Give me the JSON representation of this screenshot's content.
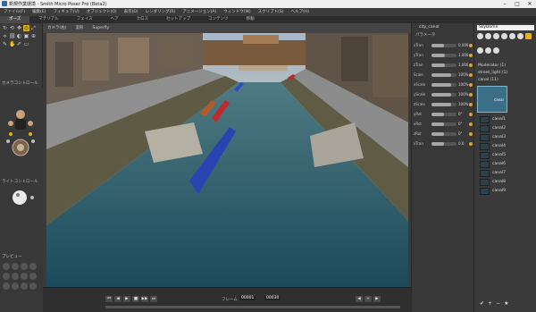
{
  "window": {
    "title": "新規作業環境 - Smith Micro Poser Pro (Beta2)"
  },
  "menu": [
    "ファイル(F)",
    "編集(E)",
    "フィギュア(U)",
    "オブジェクト(O)",
    "表示(D)",
    "レンダリング(R)",
    "アニメーション(A)",
    "ウィンドウ(W)",
    "スクリプト(S)",
    "ヘルプ(H)"
  ],
  "tabs": [
    {
      "label": "ポーズ",
      "active": true
    },
    {
      "label": "マテリアル",
      "active": false
    },
    {
      "label": "フェイス",
      "active": false
    },
    {
      "label": "ヘア",
      "active": false
    },
    {
      "label": "クロス",
      "active": false
    },
    {
      "label": "セットアップ",
      "active": false
    },
    {
      "label": "コンテンツ",
      "active": false
    },
    {
      "label": "移動",
      "active": false
    }
  ],
  "viewport": {
    "tabs": [
      "カメラ(右)",
      "変形",
      "Superfly"
    ]
  },
  "left": {
    "camera_controls_label": "カメラコントロール",
    "light_controls_label": "ライトコントロール",
    "preview_label": "プレビュー"
  },
  "params": {
    "object": "city_canal",
    "header": "パラメータ",
    "rows": [
      {
        "label": "xTran",
        "value": "0.000",
        "fill": 0.5
      },
      {
        "label": "yTran",
        "value": "1.000",
        "fill": 0.55
      },
      {
        "label": "zTran",
        "value": "1.000",
        "fill": 0.55
      },
      {
        "label": "Scale",
        "value": "100%",
        "fill": 0.8
      },
      {
        "label": "xScale",
        "value": "100%",
        "fill": 0.8
      },
      {
        "label": "yScale",
        "value": "100%",
        "fill": 0.8
      },
      {
        "label": "zScale",
        "value": "100%",
        "fill": 0.8
      },
      {
        "label": "yRot",
        "value": "0°",
        "fill": 0.5
      },
      {
        "label": "xRot",
        "value": "0°",
        "fill": 0.5
      },
      {
        "label": "zRot",
        "value": "0°",
        "fill": 0.5
      },
      {
        "label": "xTran",
        "value": "0.0",
        "fill": 0.5
      }
    ]
  },
  "library": {
    "search": "SkyDome",
    "folders": [
      {
        "label": "Moderator (1)"
      },
      {
        "label": "street_light (1)"
      },
      {
        "label": "canal (11)"
      }
    ],
    "items": [
      "canal",
      "canal1",
      "canal2",
      "canal3",
      "canal4",
      "canal5",
      "canal6",
      "canal7",
      "canal8",
      "canal9"
    ]
  },
  "timeline": {
    "frame_label": "フレーム",
    "frame": "00001",
    "total": "00030"
  }
}
